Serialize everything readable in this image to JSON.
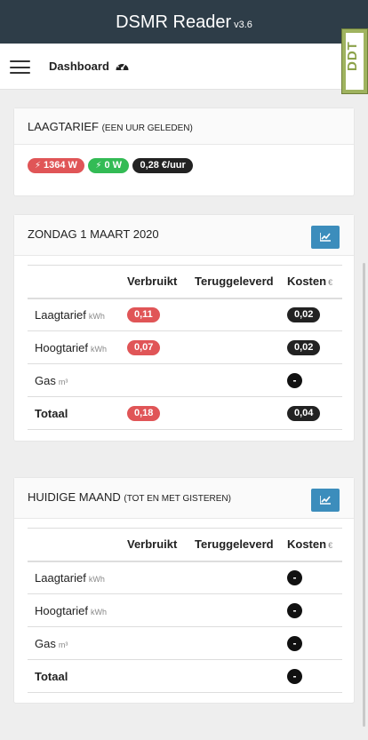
{
  "header": {
    "title": "DSMR Reader",
    "version": "v3.6"
  },
  "nav": {
    "dashboard_label": "Dashboard"
  },
  "brand_strip": {
    "text": "DDT"
  },
  "tariff_panel": {
    "title": "Laagtarief",
    "subtitle": "(een uur geleden)",
    "power_consumed": "1364 W",
    "power_returned": "0 W",
    "price": "0,28 €/uur"
  },
  "today_panel": {
    "title": "Zondag 1 maart 2020",
    "columns": {
      "verbruikt": "Verbruikt",
      "teruggeleverd": "Teruggeleverd",
      "kosten": "Kosten",
      "kosten_unit": "€"
    },
    "rows": [
      {
        "label": "Laagtarief",
        "unit": "kWh",
        "consumed": "0,11",
        "cost": "0,02"
      },
      {
        "label": "Hoogtarief",
        "unit": "kWh",
        "consumed": "0,07",
        "cost": "0,02"
      },
      {
        "label": "Gas",
        "unit": "m³",
        "consumed": "",
        "cost": "-"
      },
      {
        "label": "Totaal",
        "unit": "",
        "consumed": "0,18",
        "cost": "0,04"
      }
    ]
  },
  "month_panel": {
    "title": "Huidige maand",
    "subtitle": "(tot en met gisteren)",
    "columns": {
      "verbruikt": "Verbruikt",
      "teruggeleverd": "Teruggeleverd",
      "kosten": "Kosten",
      "kosten_unit": "€"
    },
    "rows": [
      {
        "label": "Laagtarief",
        "unit": "kWh",
        "cost": "-"
      },
      {
        "label": "Hoogtarief",
        "unit": "kWh",
        "cost": "-"
      },
      {
        "label": "Gas",
        "unit": "m³",
        "cost": "-"
      },
      {
        "label": "Totaal",
        "unit": "",
        "cost": "-"
      }
    ]
  },
  "colors": {
    "header_bg": "#2e3d48",
    "accent": "#3c8dbc",
    "danger": "#e05557",
    "success": "#33bb55"
  }
}
